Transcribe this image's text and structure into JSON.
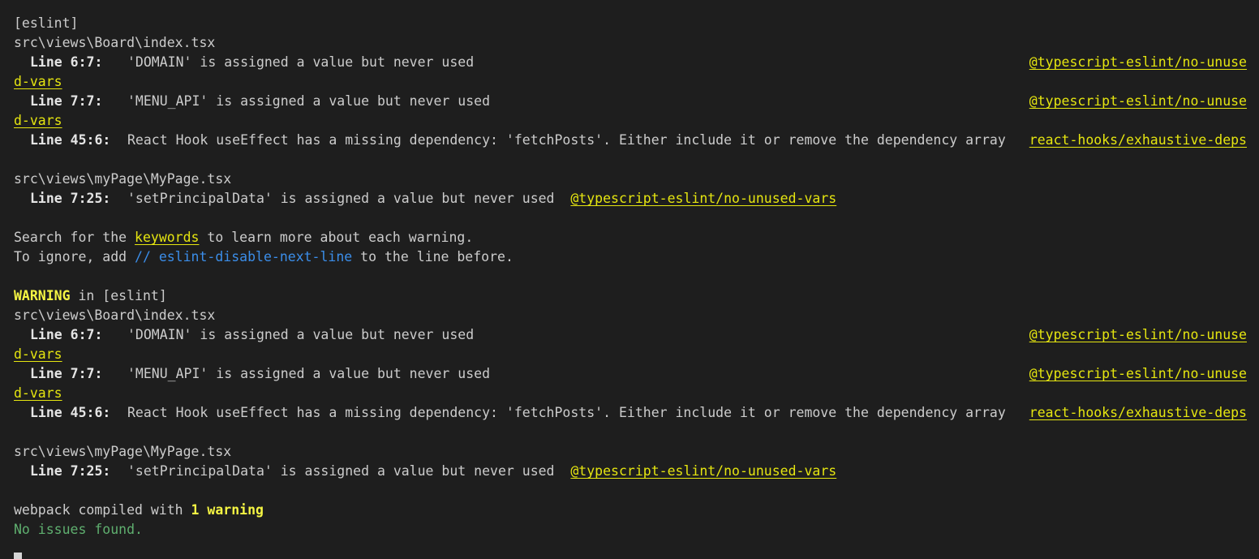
{
  "block1": {
    "header": "[eslint]",
    "file1": "src\\views\\Board\\index.tsx",
    "w1": {
      "loc": "Line 6:7:",
      "msg": "'DOMAIN' is assigned a value but never used",
      "rule_a": "@typescript-eslint/no-unuse",
      "rule_b": "d-vars"
    },
    "w2": {
      "loc": "Line 7:7:",
      "msg": "'MENU_API' is assigned a value but never used",
      "rule_a": "@typescript-eslint/no-unuse",
      "rule_b": "d-vars"
    },
    "w3": {
      "loc": "Line 45:6:",
      "msg": "React Hook useEffect has a missing dependency: 'fetchPosts'. Either include it or remove the dependency array",
      "rule": "react-hooks/exhaustive-deps"
    },
    "file2": "src\\views\\myPage\\MyPage.tsx",
    "w4": {
      "loc": "Line 7:25:",
      "msg": "'setPrincipalData' is assigned a value but never used",
      "rule": "@typescript-eslint/no-unused-vars"
    }
  },
  "hint": {
    "search_pre": "Search for the ",
    "search_kw": "keywords",
    "search_post": " to learn more about each warning.",
    "ignore_pre": "To ignore, add ",
    "ignore_comment": "// eslint-disable-next-line",
    "ignore_post": " to the line before."
  },
  "block2": {
    "warning_word": "WARNING",
    "warning_rest": " in [eslint]",
    "file1": "src\\views\\Board\\index.tsx",
    "w1": {
      "loc": "Line 6:7:",
      "msg": "'DOMAIN' is assigned a value but never used",
      "rule_a": "@typescript-eslint/no-unuse",
      "rule_b": "d-vars"
    },
    "w2": {
      "loc": "Line 7:7:",
      "msg": "'MENU_API' is assigned a value but never used",
      "rule_a": "@typescript-eslint/no-unuse",
      "rule_b": "d-vars"
    },
    "w3": {
      "loc": "Line 45:6:",
      "msg": "React Hook useEffect has a missing dependency: 'fetchPosts'. Either include it or remove the dependency array",
      "rule": "react-hooks/exhaustive-deps"
    },
    "file2": "src\\views\\myPage\\MyPage.tsx",
    "w4": {
      "loc": "Line 7:25:",
      "msg": "'setPrincipalData' is assigned a value but never used",
      "rule": "@typescript-eslint/no-unused-vars"
    }
  },
  "footer": {
    "compiled_pre": "webpack compiled with ",
    "compiled_count": "1 warning",
    "status": "No issues found."
  },
  "colors": {
    "background": "#1e1e1e",
    "text": "#cccccc",
    "rule_yellow": "#e5e510",
    "comment_blue": "#3b8eea",
    "success_green": "#5faf6f"
  }
}
